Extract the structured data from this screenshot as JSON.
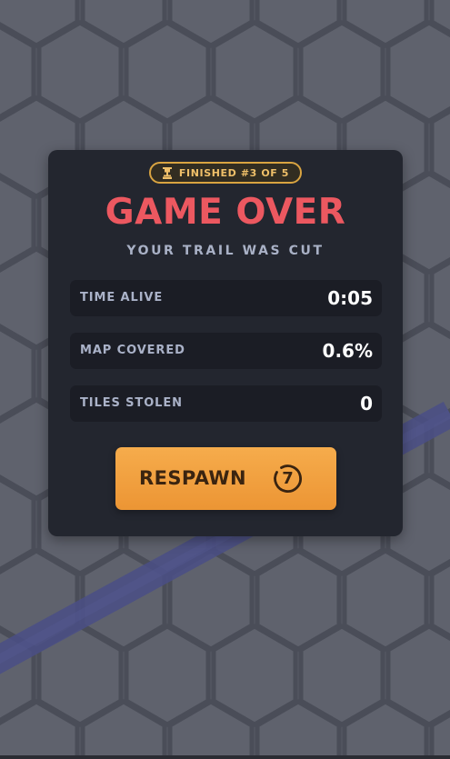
{
  "game_over": {
    "badge": {
      "icon": "trophy-icon",
      "text": "FINISHED #3 OF 5"
    },
    "title": "GAME OVER",
    "subtitle": "YOUR TRAIL WAS CUT",
    "stats": [
      {
        "label": "TIME ALIVE",
        "value": "0:05"
      },
      {
        "label": "MAP COVERED",
        "value": "0.6%"
      },
      {
        "label": "TILES STOLEN",
        "value": "0"
      }
    ],
    "respawn": {
      "label": "RESPAWN",
      "countdown": "7",
      "icon": "countdown-timer-icon"
    }
  },
  "colors": {
    "background": "#585b66",
    "hex_line": "#4a4d58",
    "trail": "#4a4f86",
    "panel": "#23262f",
    "stat_row": "#1b1d25",
    "title": "#ec5860",
    "badge_border": "#d9a441",
    "button": "#f2a040",
    "button_text": "#3a2410"
  }
}
